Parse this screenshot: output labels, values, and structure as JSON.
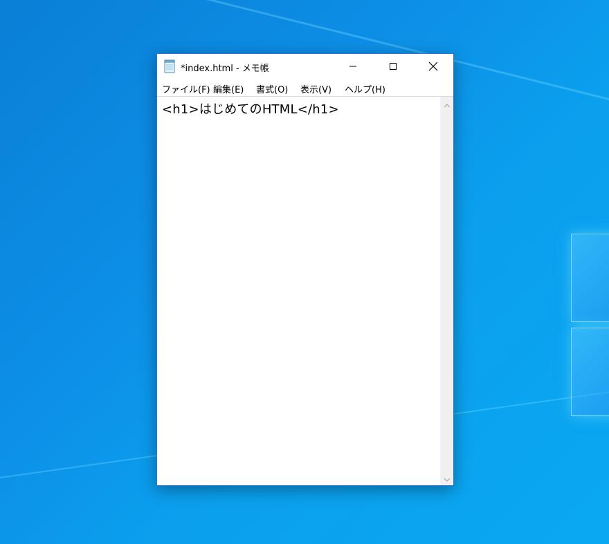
{
  "window": {
    "title": "*index.html - メモ帳",
    "icon": "notepad-icon"
  },
  "caption_buttons": {
    "minimize": "minimize-icon",
    "maximize": "maximize-icon",
    "close": "close-icon"
  },
  "menu": {
    "items": [
      {
        "label": "ファイル(F)"
      },
      {
        "label": "編集(E)"
      },
      {
        "label": "書式(O)"
      },
      {
        "label": "表示(V)"
      },
      {
        "label": "ヘルプ(H)"
      }
    ]
  },
  "editor": {
    "content": "<h1>はじめてのHTML</h1>"
  },
  "colors": {
    "desktop_blue": "#0d8ee6",
    "window_border": "#2b78c8",
    "scrollbar": "#f0f0f0"
  }
}
